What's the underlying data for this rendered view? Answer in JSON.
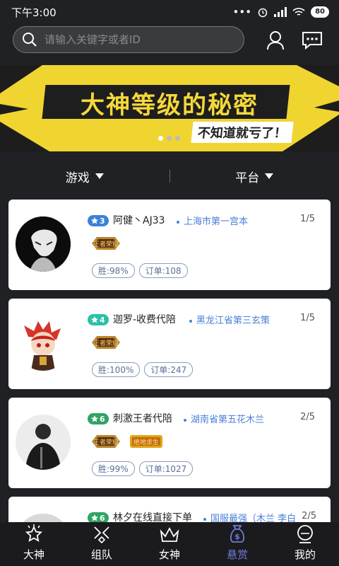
{
  "status": {
    "time": "下午3:00",
    "battery": "80"
  },
  "search": {
    "placeholder": "请输入关键字或者ID"
  },
  "banner": {
    "title": "大神等级的秘密",
    "subtitle": "不知道就亏了！"
  },
  "filters": {
    "game": "游戏",
    "platform": "平台"
  },
  "cards": [
    {
      "level": "3",
      "level_color": "#3b82d6",
      "name": "阿健丶AJ33",
      "location": "上海市第一宫本",
      "count": "1/5",
      "games": [
        "王者荣耀"
      ],
      "win": "胜:98%",
      "orders": "订单:108"
    },
    {
      "level": "4",
      "level_color": "#2bc0a8",
      "name": "迦罗-收费代陪",
      "location": "黑龙江省第三玄策",
      "count": "1/5",
      "games": [
        "王者荣耀"
      ],
      "win": "胜:100%",
      "orders": "订单:247"
    },
    {
      "level": "6",
      "level_color": "#2fa463",
      "name": "刺激王者代陪",
      "location": "湖南省第五花木兰",
      "count": "2/5",
      "games": [
        "王者荣耀",
        "绝地求生"
      ],
      "win": "胜:99%",
      "orders": "订单:1027"
    },
    {
      "level": "6",
      "level_color": "#2fa463",
      "name": "林夕在线直接下单",
      "location": "国服最强（木兰 李白",
      "count": "2/5"
    }
  ],
  "tabs": [
    "大神",
    "组队",
    "女神",
    "悬赏",
    "我的"
  ],
  "colors": {
    "accent": "#6d7cd8",
    "banner_yellow": "#f0d531",
    "location_blue": "#4a7fd6"
  }
}
